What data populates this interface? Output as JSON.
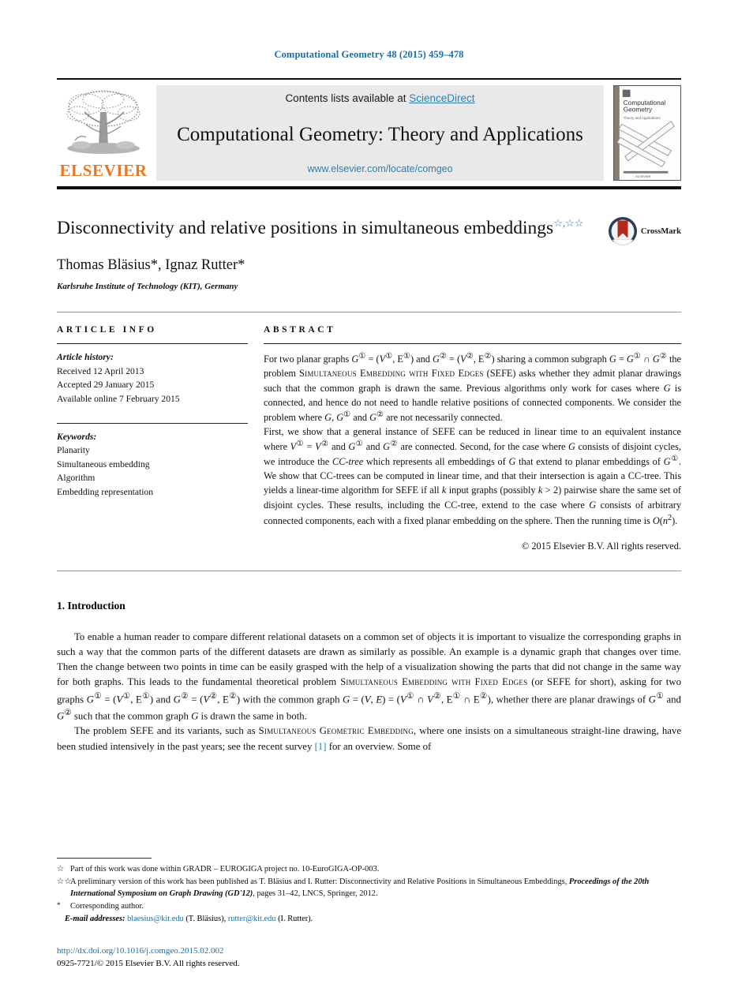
{
  "running_head": "Computational Geometry 48 (2015) 459–478",
  "masthead": {
    "contents_prefix": "Contents lists available at ",
    "sciencedirect": "ScienceDirect",
    "journal_name": "Computational Geometry: Theory and Applications",
    "journal_url": "www.elsevier.com/locate/comgeo",
    "publisher": "ELSEVIER",
    "cover_title_line1": "Computational",
    "cover_title_line2": "Geometry",
    "cover_subtitle": "Theory and Applications"
  },
  "title": {
    "text": "Disconnectivity and relative positions in simultaneous embeddings",
    "footnote_marks": "☆,☆☆"
  },
  "authors": {
    "list": "Thomas Bläsius*, Ignaz Rutter*",
    "affiliation": "Karlsruhe Institute of Technology (KIT), Germany"
  },
  "crossmark": {
    "label": "CrossMark"
  },
  "article_info": {
    "heading": "ARTICLE INFO",
    "history_label": "Article history:",
    "history": [
      "Received 12 April 2013",
      "Accepted 29 January 2015",
      "Available online 7 February 2015"
    ],
    "keywords_label": "Keywords:",
    "keywords": [
      "Planarity",
      "Simultaneous embedding",
      "Algorithm",
      "Embedding representation"
    ]
  },
  "abstract": {
    "heading": "ABSTRACT",
    "para1_a": "For two planar graphs ",
    "para1_b": " the problem ",
    "sefe_caps": "Simultaneous Embedding with Fixed Edges",
    "para1_c": " (SEFE) asks whether they admit planar drawings such that the common graph is drawn the same. Previous algorithms only work for cases where ",
    "para1_d": " is connected, and hence do not need to handle relative positions of connected components. We consider the problem where ",
    "para1_e": " are not necessarily connected.",
    "para2_a": "First, we show that a general instance of SEFE can be reduced in linear time to an equivalent instance where ",
    "para2_b": " are connected. Second, for the case where ",
    "para2_c": " consists of disjoint cycles, we introduce the ",
    "cc_tree": "CC-tree",
    "para2_d": " which represents all embeddings of ",
    "para2_e": " that extend to planar embeddings of ",
    "para2_f": ". We show that CC-trees can be computed in linear time, and that their intersection is again a CC-tree. This yields a linear-time algorithm for SEFE if all ",
    "para2_g": " input graphs (possibly ",
    "para2_h": ") pairwise share the same set of disjoint cycles. These results, including the CC-tree, extend to the case where ",
    "para2_i": " consists of arbitrary connected components, each with a fixed planar embedding on the sphere. Then the running time is ",
    "copyright": "© 2015 Elsevier B.V. All rights reserved."
  },
  "introduction": {
    "heading": "1. Introduction",
    "para1": "To enable a human reader to compare different relational datasets on a common set of objects it is important to visualize the corresponding graphs in such a way that the common parts of the different datasets are drawn as similarly as possible. An example is a dynamic graph that changes over time. Then the change between two points in time can be easily grasped with the help of a visualization showing the parts that did not change in the same way for both graphs. This leads to the fundamental theoretical problem ",
    "sefe_caps": "Simultaneous Embedding with Fixed Edges",
    "para1_b": " (or SEFE for short), asking for two graphs ",
    "para1_c": " with the common graph ",
    "para1_d": ", whether there are planar drawings of ",
    "para1_e": " such that the common graph ",
    "para1_f": " is drawn the same in both.",
    "para2_a": "The problem SEFE and its variants, such as ",
    "sge_caps": "Simultaneous Geometric Embedding",
    "para2_b": ", where one insists on a simultaneous straight-line drawing, have been studied intensively in the past years; see the recent survey ",
    "citation": "[1]",
    "para2_c": " for an overview. Some of"
  },
  "footnotes": {
    "fn1_mark": "☆",
    "fn1_text": "Part of this work was done within GRADR – EUROGIGA project no. 10-EuroGIGA-OP-003.",
    "fn2_mark": "☆☆",
    "fn2_text": "A preliminary version of this work has been published as T. Bläsius and I. Rutter: Disconnectivity and Relative Positions in Simultaneous Embeddings, ",
    "fn2_italic": "Proceedings of the 20th International Symposium on Graph Drawing (GD'12)",
    "fn2_tail": ", pages 31–42, LNCS, Springer, 2012.",
    "fn3_mark": "*",
    "fn3_text": "Corresponding author.",
    "email_label": "E-mail addresses:",
    "email1": "blaesius@kit.edu",
    "email1_who": "(T. Bläsius),",
    "email2": "rutter@kit.edu",
    "email2_who": "(I. Rutter)."
  },
  "bottom": {
    "doi": "http://dx.doi.org/10.1016/j.comgeo.2015.02.002",
    "issn_line": "0925-7721/© 2015 Elsevier B.V. All rights reserved."
  },
  "colors": {
    "link_blue": "#2e7fb0",
    "head_blue": "#1c6ea4",
    "elsevier_orange": "#e87722",
    "masthead_gray": "#e9e9e9",
    "crossmark_red": "#b4281e",
    "crossmark_navy": "#2b3c55"
  }
}
